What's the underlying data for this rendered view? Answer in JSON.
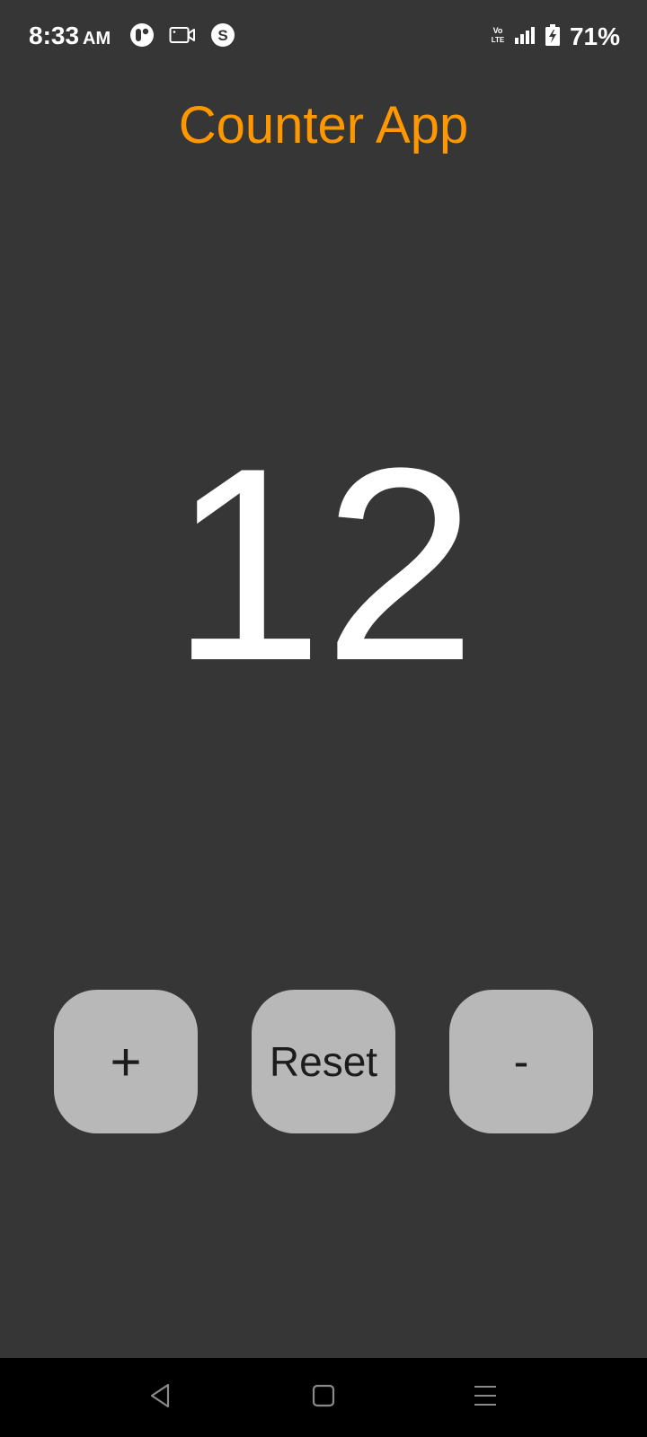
{
  "status_bar": {
    "time": "8:33",
    "ampm": "AM",
    "battery_percent": "71%",
    "network_label": "Vo LTE",
    "left_icons": [
      "app-notification-icon",
      "screen-record-icon",
      "s-app-icon"
    ],
    "right_icons": [
      "volte-icon",
      "signal-icon",
      "battery-charging-icon"
    ]
  },
  "app": {
    "title": "Counter App",
    "title_color": "#ff9800",
    "background_color": "#363636"
  },
  "counter": {
    "value": "12"
  },
  "buttons": {
    "increment_label": "+",
    "reset_label": "Reset",
    "decrement_label": "-",
    "button_color": "#b8b8b8"
  },
  "nav_bar": {
    "icons": [
      "back-icon",
      "home-icon",
      "recents-icon"
    ]
  }
}
